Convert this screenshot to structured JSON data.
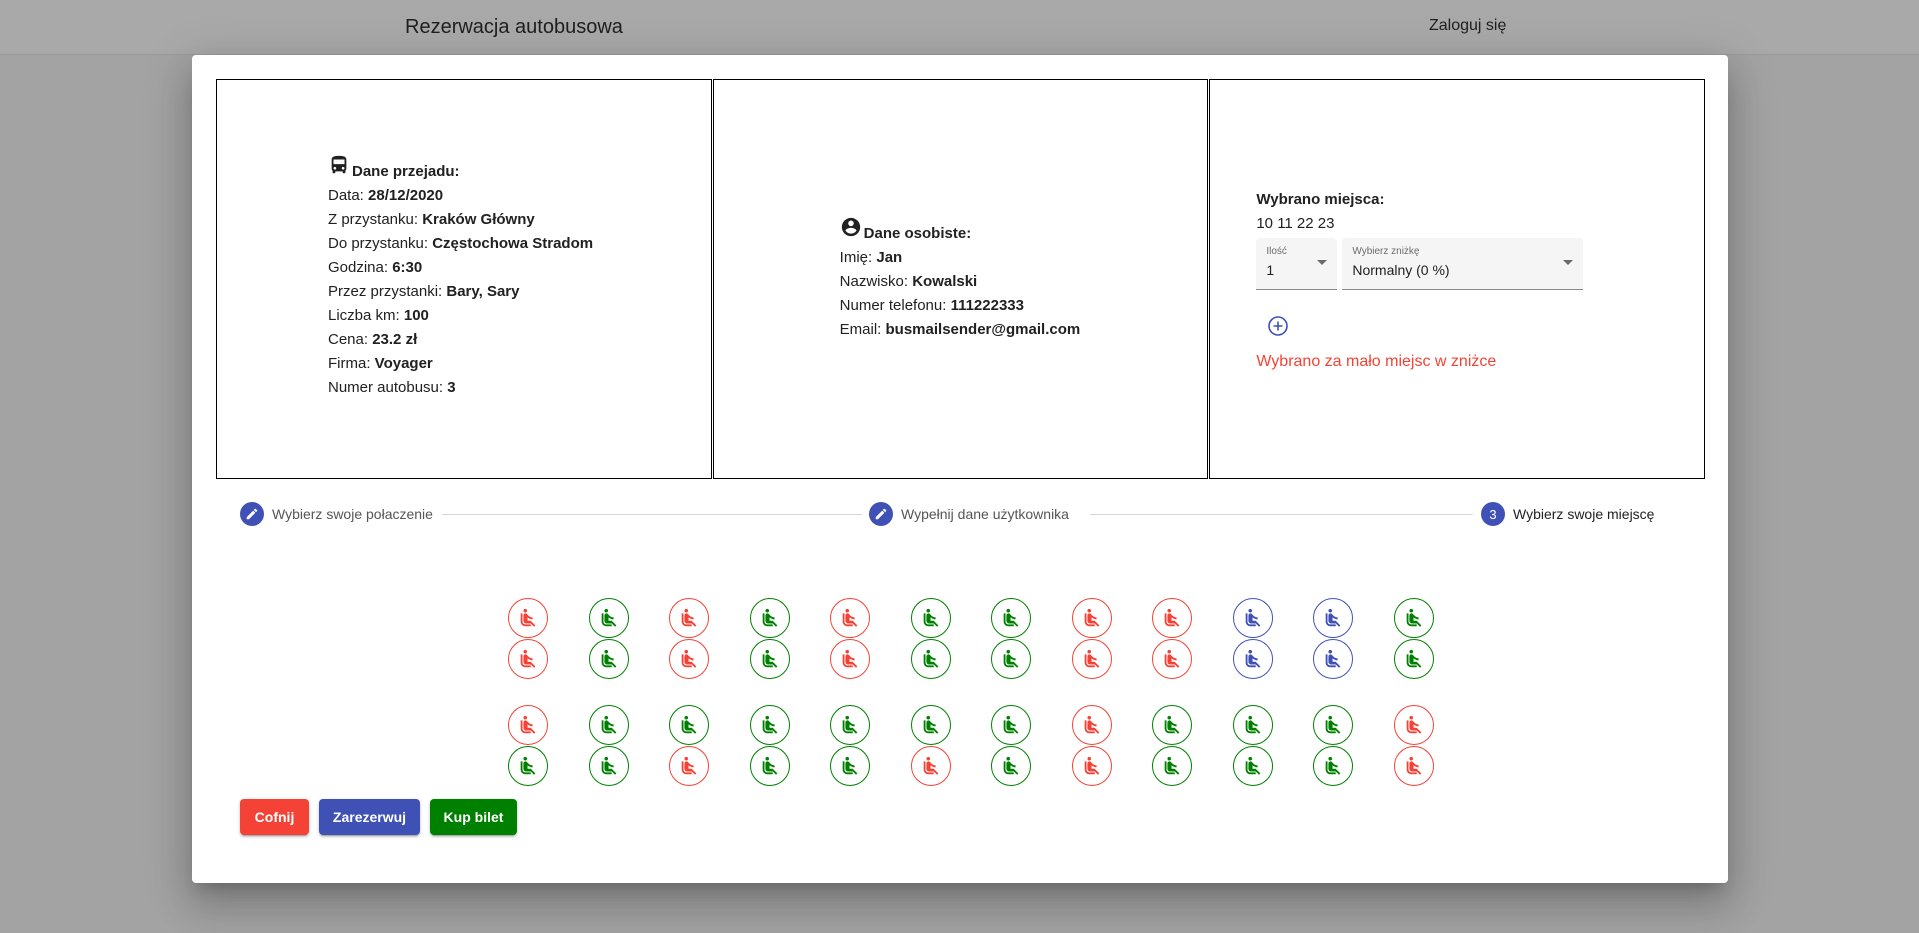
{
  "header": {
    "title": "Rezerwacja autobusowa",
    "login": "Zaloguj się"
  },
  "trip": {
    "heading": "Dane przejadu:",
    "icon": "bus-icon",
    "rows": [
      {
        "label": "Data: ",
        "value": "28/12/2020"
      },
      {
        "label": "Z przystanku: ",
        "value": "Kraków Główny"
      },
      {
        "label": "Do przystanku: ",
        "value": "Częstochowa Stradom"
      },
      {
        "label": "Godzina: ",
        "value": "6:30"
      },
      {
        "label": "Przez przystanki: ",
        "value": "Bary, Sary"
      },
      {
        "label": "Liczba km: ",
        "value": "100"
      },
      {
        "label": "Cena: ",
        "value": "23.2 zł"
      },
      {
        "label": "Firma: ",
        "value": "Voyager"
      },
      {
        "label": "Numer autobusu: ",
        "value": "3"
      }
    ]
  },
  "personal": {
    "heading": "Dane osobiste:",
    "icon": "account-circle-icon",
    "rows": [
      {
        "label": "Imię: ",
        "value": "Jan"
      },
      {
        "label": "Nazwisko: ",
        "value": "Kowalski"
      },
      {
        "label": "Numer telefonu: ",
        "value": "111222333"
      },
      {
        "label": "Email: ",
        "value": "busmailsender@gmail.com"
      }
    ]
  },
  "selection": {
    "heading": "Wybrano miejsca:",
    "seats": "10 11 22 23",
    "quantity": {
      "label": "Ilość",
      "value": "1"
    },
    "discount": {
      "label": "Wybierz zniżkę",
      "value": "Normalny (0 %)"
    },
    "add_icon": "add-circle-outline-icon",
    "error": "Wybrano za mało miejsc w zniżce"
  },
  "stepper": {
    "steps": [
      {
        "label": "Wybierz swoje połaczenie",
        "icon": "edit-icon",
        "number": ""
      },
      {
        "label": "Wypełnij dane użytkownika",
        "icon": "edit-icon",
        "number": ""
      },
      {
        "label": "Wybierz swoje miejscę",
        "icon": "",
        "number": "3"
      }
    ]
  },
  "seat_map": {
    "colors": {
      "taken": "#f44336",
      "free": "#008000",
      "selected": "#3f51b5"
    },
    "icon": "seat-icon",
    "rows": [
      [
        "taken",
        "free",
        "taken",
        "free",
        "taken",
        "free",
        "free",
        "taken",
        "taken",
        "selected",
        "selected",
        "free"
      ],
      [
        "taken",
        "free",
        "taken",
        "free",
        "taken",
        "free",
        "free",
        "taken",
        "taken",
        "selected",
        "selected",
        "free"
      ],
      [
        "taken",
        "free",
        "free",
        "free",
        "free",
        "free",
        "free",
        "taken",
        "free",
        "free",
        "free",
        "taken"
      ],
      [
        "free",
        "free",
        "taken",
        "free",
        "free",
        "taken",
        "free",
        "taken",
        "free",
        "free",
        "free",
        "taken"
      ]
    ]
  },
  "buttons": {
    "back": "Cofnij",
    "reserve": "Zarezerwuj",
    "buy": "Kup bilet"
  }
}
